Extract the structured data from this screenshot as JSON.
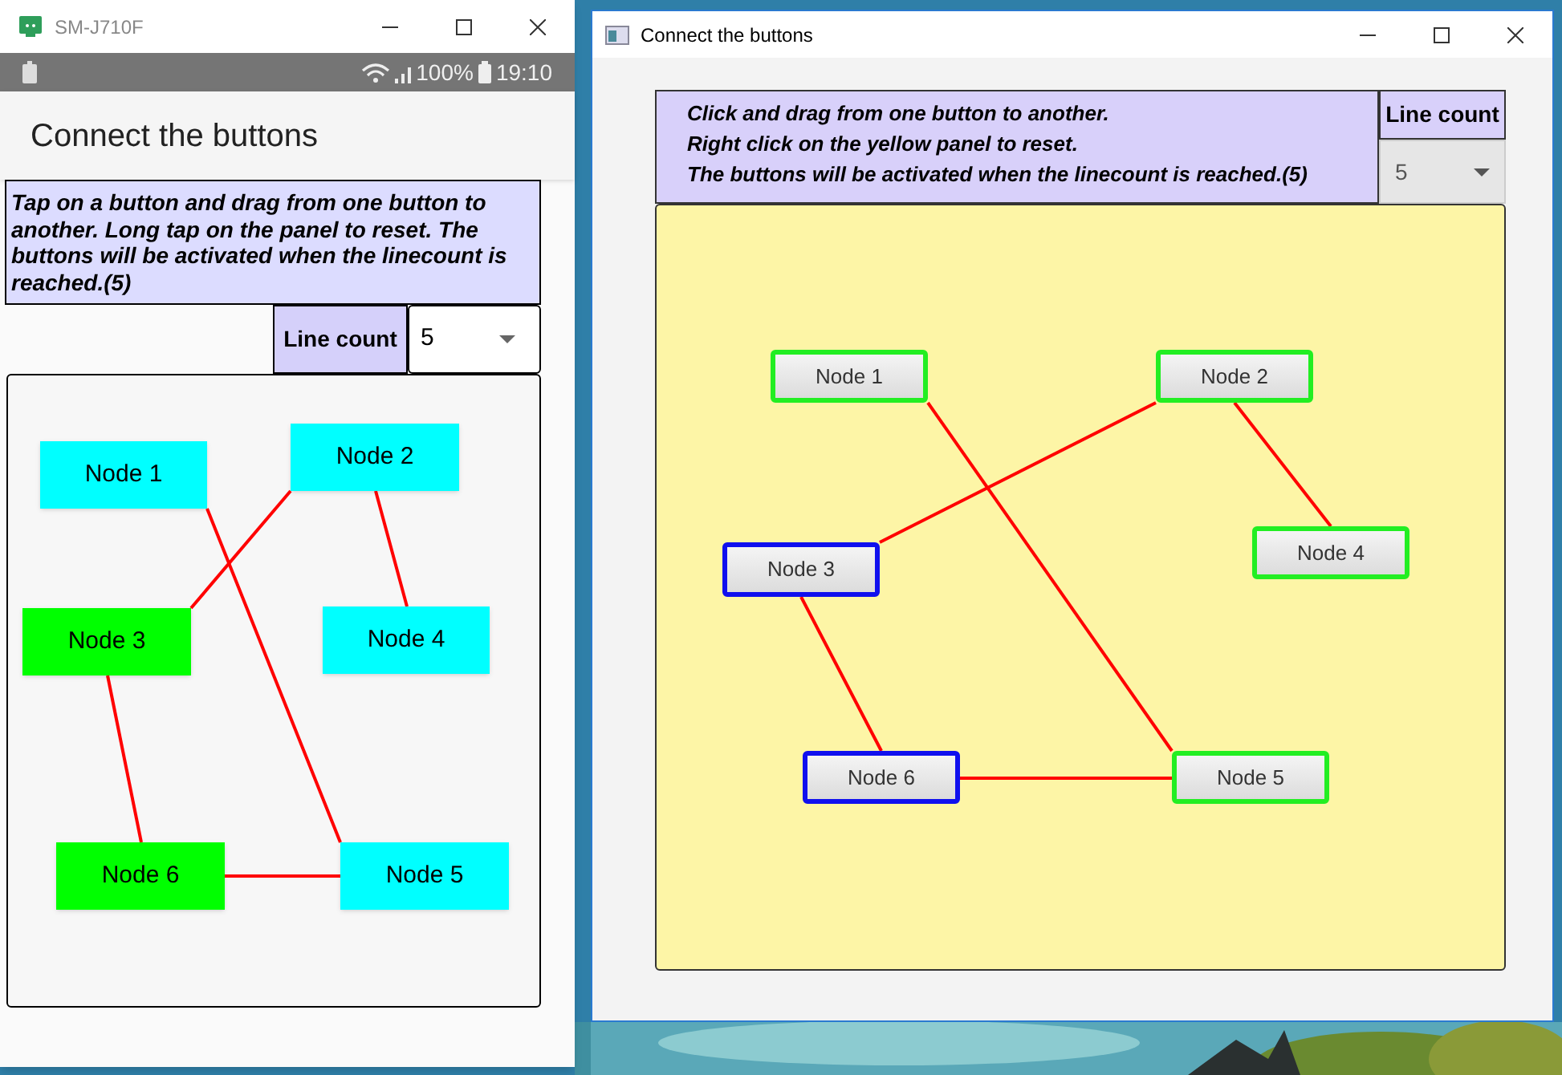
{
  "windows": [
    {
      "kind": "android",
      "title": "SM-J710F",
      "status_bar": {
        "battery_percent": "100%",
        "time": "19:10"
      },
      "app_title": "Connect the buttons",
      "instructions": "Tap on a button and drag from one button to another. Long tap on the panel to reset. The buttons will be activated when the linecount is reached.(5)",
      "line_count_label": "Line count",
      "line_count_value": "5",
      "nodes": [
        {
          "label": "Node 1",
          "color": "#00ffff"
        },
        {
          "label": "Node 2",
          "color": "#00ffff"
        },
        {
          "label": "Node 3",
          "color": "#00ff00"
        },
        {
          "label": "Node 4",
          "color": "#00ffff"
        },
        {
          "label": "Node 5",
          "color": "#00ffff"
        },
        {
          "label": "Node 6",
          "color": "#00ff00"
        }
      ]
    },
    {
      "kind": "desktop",
      "title": "Connect the buttons",
      "instruction_lines": [
        "Click and drag from one button to another.",
        "Right click on the yellow panel to reset.",
        "The buttons will be activated when the linecount is reached.(5)"
      ],
      "line_count_label": "Line count",
      "line_count_value": "5",
      "nodes": [
        {
          "label": "Node 1",
          "color": "#22ee22"
        },
        {
          "label": "Node 2",
          "color": "#22ee22"
        },
        {
          "label": "Node 3",
          "color": "#1010ee"
        },
        {
          "label": "Node 4",
          "color": "#22ee22"
        },
        {
          "label": "Node 5",
          "color": "#22ee22"
        },
        {
          "label": "Node 6",
          "color": "#1010ee"
        }
      ]
    }
  ]
}
